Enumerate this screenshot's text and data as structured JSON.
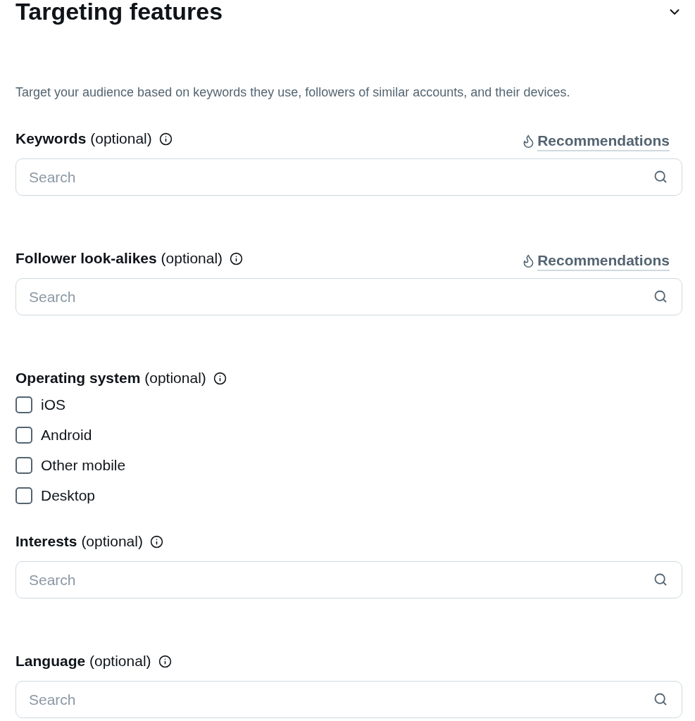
{
  "title": "Targeting features",
  "collapse_expanded": true,
  "description": "Target your audience based on keywords they use, followers of similar accounts, and their devices.",
  "sections": [
    {
      "kind": "search",
      "label": "**Keywords** (optional)",
      "recommendations": "Recommendations",
      "placeholder": "Search"
    },
    {
      "kind": "search",
      "label": "**Follower look-alikes** (optional)",
      "recommendations": "Recommendations",
      "placeholder": "Search"
    },
    {
      "kind": "checkboxes",
      "label": "**Operating system** (optional)",
      "options": [
        {
          "label": "iOS",
          "checked": false
        },
        {
          "label": "Android",
          "checked": false
        },
        {
          "label": "Other mobile",
          "checked": false
        },
        {
          "label": "Desktop",
          "checked": false
        }
      ]
    },
    {
      "kind": "search",
      "label": "**Interests** (optional)",
      "placeholder": "Search"
    },
    {
      "kind": "search",
      "label": "**Language** (optional)",
      "placeholder": "Search"
    }
  ]
}
